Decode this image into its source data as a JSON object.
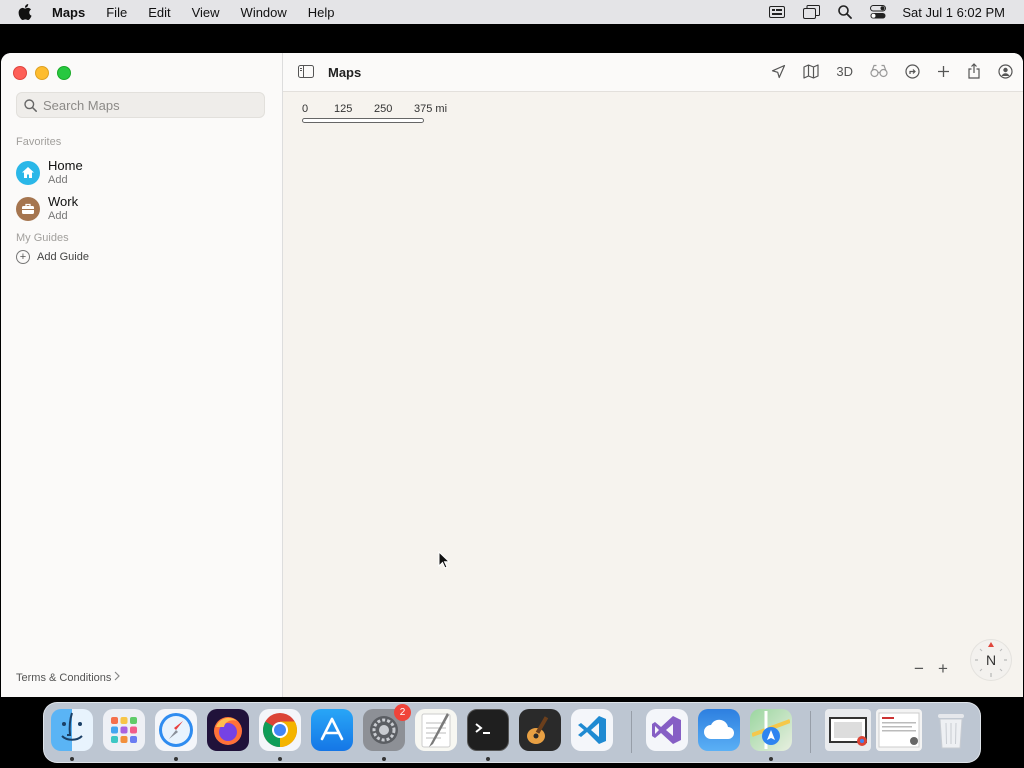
{
  "menubar": {
    "app_name": "Maps",
    "menus": [
      "File",
      "Edit",
      "View",
      "Window",
      "Help"
    ],
    "clock": "Sat Jul 1  6:02 PM",
    "status_icons": [
      "keyboard-icon",
      "screen-mirroring-icon",
      "spotlight-search-icon",
      "control-center-icon"
    ]
  },
  "sidebar": {
    "search_placeholder": "Search Maps",
    "favorites_header": "Favorites",
    "favorites": [
      {
        "title": "Home",
        "subtitle": "Add",
        "icon": "home-icon",
        "color": "#2ab7e8"
      },
      {
        "title": "Work",
        "subtitle": "Add",
        "icon": "briefcase-icon",
        "color": "#a5754f"
      }
    ],
    "guides_header": "My Guides",
    "add_guide_label": "Add Guide",
    "terms_label": "Terms & Conditions"
  },
  "toolbar": {
    "title": "Maps",
    "three_d_label": "3D",
    "icons": [
      "sidebar-toggle-icon",
      "location-arrow-icon",
      "map-mode-icon",
      "3d-button",
      "look-around-icon",
      "directions-icon",
      "add-icon",
      "share-icon",
      "account-icon"
    ]
  },
  "map": {
    "scale_labels": [
      "0",
      "125",
      "250",
      "375 mi"
    ],
    "zoom_out": "−",
    "zoom_in": "+",
    "compass_label": "N"
  },
  "dock": {
    "apps": [
      "Finder",
      "Launchpad",
      "Safari",
      "Firefox",
      "Google Chrome",
      "App Store",
      "System Settings",
      "TextEdit",
      "Terminal",
      "GarageBand",
      "Visual Studio Code",
      "Visual Studio",
      "Weather",
      "Maps",
      "Chrome Window",
      "Preview Window",
      "Trash"
    ],
    "settings_badge": "2"
  }
}
